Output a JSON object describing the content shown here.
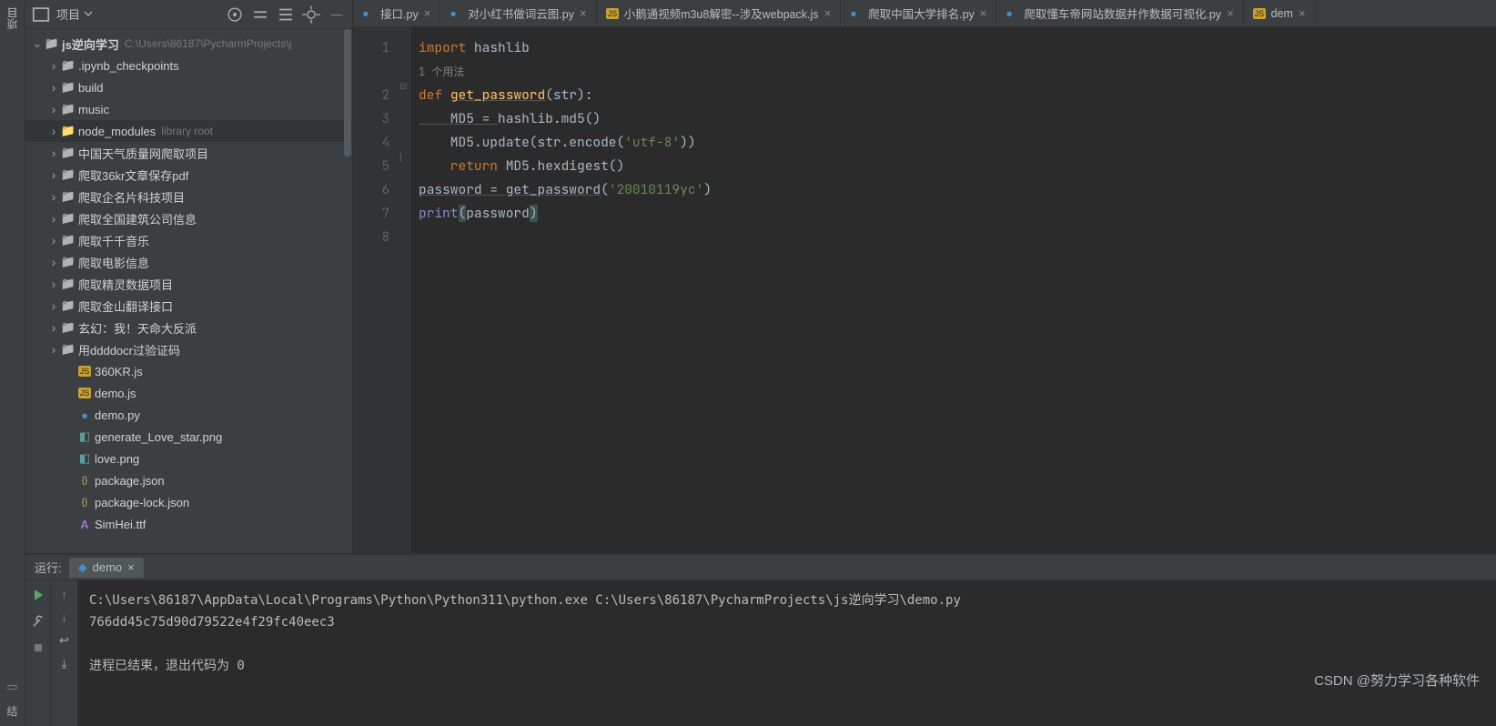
{
  "leftRail": {
    "label": "项目"
  },
  "projectPanel": {
    "title": "项目",
    "rootName": "js逆向学习",
    "rootPath": "C:\\Users\\86187\\PycharmProjects\\j",
    "items": [
      {
        "indent": 1,
        "chev": "right",
        "icon": "folder",
        "label": ".ipynb_checkpoints"
      },
      {
        "indent": 1,
        "chev": "right",
        "icon": "folder",
        "label": "build"
      },
      {
        "indent": 1,
        "chev": "right",
        "icon": "folder",
        "label": "music"
      },
      {
        "indent": 1,
        "chev": "right",
        "icon": "folder-orange",
        "label": "node_modules",
        "hint": "library root",
        "highlight": true
      },
      {
        "indent": 1,
        "chev": "right",
        "icon": "folder",
        "label": "中国天气质量网爬取项目"
      },
      {
        "indent": 1,
        "chev": "right",
        "icon": "folder",
        "label": "爬取36kr文章保存pdf"
      },
      {
        "indent": 1,
        "chev": "right",
        "icon": "folder",
        "label": "爬取企名片科技项目"
      },
      {
        "indent": 1,
        "chev": "right",
        "icon": "folder",
        "label": "爬取全国建筑公司信息"
      },
      {
        "indent": 1,
        "chev": "right",
        "icon": "folder",
        "label": "爬取千千音乐"
      },
      {
        "indent": 1,
        "chev": "right",
        "icon": "folder",
        "label": "爬取电影信息"
      },
      {
        "indent": 1,
        "chev": "right",
        "icon": "folder",
        "label": "爬取精灵数据项目"
      },
      {
        "indent": 1,
        "chev": "right",
        "icon": "folder",
        "label": "爬取金山翻译接口"
      },
      {
        "indent": 1,
        "chev": "right",
        "icon": "folder",
        "label": "玄幻：我！天命大反派"
      },
      {
        "indent": 1,
        "chev": "right",
        "icon": "folder",
        "label": "用ddddocr过验证码"
      },
      {
        "indent": 2,
        "chev": "",
        "icon": "js",
        "label": "360KR.js"
      },
      {
        "indent": 2,
        "chev": "",
        "icon": "js",
        "label": "demo.js"
      },
      {
        "indent": 2,
        "chev": "",
        "icon": "py",
        "label": "demo.py"
      },
      {
        "indent": 2,
        "chev": "",
        "icon": "png",
        "label": "generate_Love_star.png"
      },
      {
        "indent": 2,
        "chev": "",
        "icon": "png",
        "label": "love.png"
      },
      {
        "indent": 2,
        "chev": "",
        "icon": "json",
        "label": "package.json"
      },
      {
        "indent": 2,
        "chev": "",
        "icon": "json",
        "label": "package-lock.json"
      },
      {
        "indent": 2,
        "chev": "",
        "icon": "ttf",
        "label": "SimHei.ttf"
      }
    ]
  },
  "tabs": [
    {
      "icon": "py",
      "label": "接口.py"
    },
    {
      "icon": "py",
      "label": "对小红书做词云图.py"
    },
    {
      "icon": "js",
      "label": "小鹅通视频m3u8解密--涉及webpack.js"
    },
    {
      "icon": "py",
      "label": "爬取中国大学排名.py"
    },
    {
      "icon": "py",
      "label": "爬取懂车帝网站数据并作数据可视化.py"
    },
    {
      "icon": "js",
      "label": "dem"
    }
  ],
  "gutterLines": [
    "1",
    "2",
    "3",
    "4",
    "5",
    "6",
    "7",
    "8"
  ],
  "code": {
    "hint": "1 个用法",
    "l1a": "import ",
    "l1b": "hashlib",
    "l3a": "def ",
    "l3b": "get_password",
    "l3c": "(str):",
    "l4a": "    MD5 = ",
    "l4b": "hashlib.md5()",
    "l5a": "    MD5.update(str.encode(",
    "l5b": "'utf-8'",
    "l5c": "))",
    "l6a": "    return ",
    "l6b": "MD5.hexdigest()",
    "l7a": "password = ",
    "l7b": "get_password",
    "l7c": "(",
    "l7d": "'20010119yc'",
    "l7e": ")",
    "l8a": "print",
    "l8b": "(",
    "l8c": "password",
    "l8d": ")"
  },
  "run": {
    "label": "运行:",
    "tabName": "demo",
    "lines": [
      "C:\\Users\\86187\\AppData\\Local\\Programs\\Python\\Python311\\python.exe C:\\Users\\86187\\PycharmProjects\\js逆向学习\\demo.py",
      "766dd45c75d90d79522e4f29fc40eec3",
      "",
      "进程已结束，退出代码为 0"
    ]
  },
  "watermark": "CSDN @努力学习各种软件",
  "bottomLeft": "结"
}
